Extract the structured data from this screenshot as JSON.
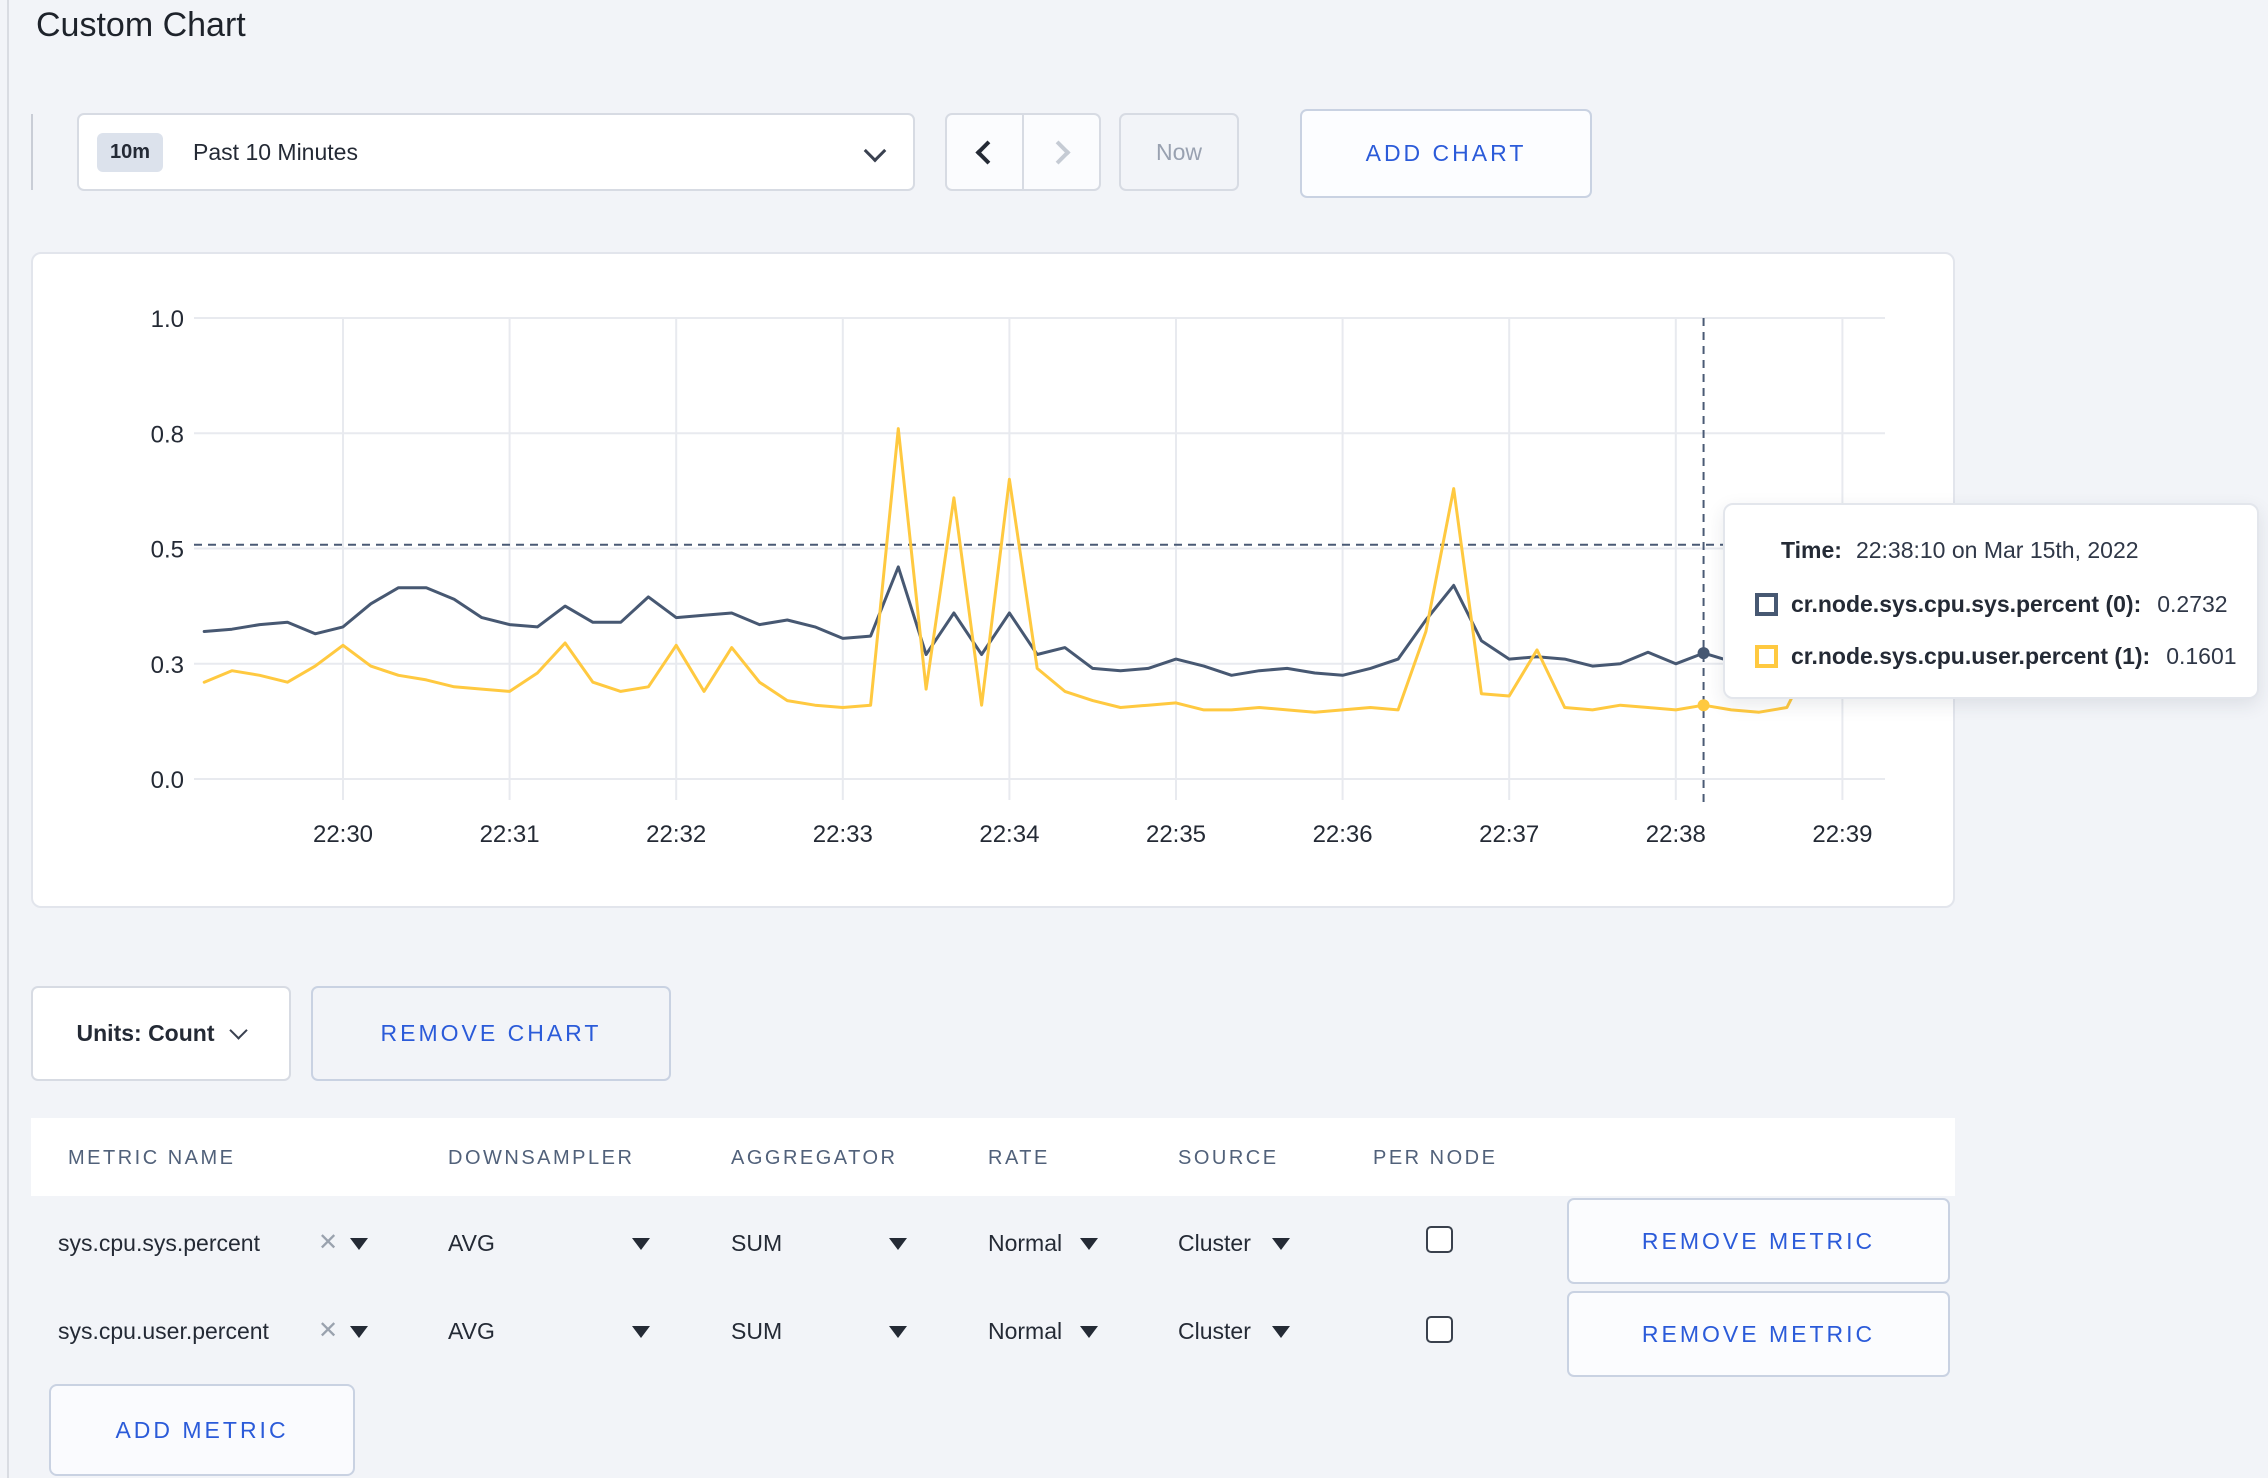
{
  "page": {
    "title": "Custom Chart"
  },
  "toolbar": {
    "time_range": {
      "badge": "10m",
      "label": "Past 10 Minutes"
    },
    "now_label": "Now",
    "add_chart_label": "ADD CHART"
  },
  "icons": {
    "clear": "✕"
  },
  "chart_data": {
    "type": "line",
    "title": "",
    "xlabel": "",
    "ylabel": "",
    "grid": true,
    "legend_position": "tooltip",
    "x_axis": {
      "tick_labels": [
        "22:30",
        "22:31",
        "22:32",
        "22:33",
        "22:34",
        "22:35",
        "22:36",
        "22:37",
        "22:38",
        "22:39"
      ],
      "start_time": "22:29:10",
      "interval_seconds": 10,
      "point_count": 61
    },
    "y_axis": {
      "tick_labels": [
        "0.0",
        "0.3",
        "0.5",
        "0.8",
        "1.0"
      ],
      "tick_values": [
        0,
        0.25,
        0.5,
        0.75,
        1
      ],
      "range": [
        0,
        1
      ]
    },
    "series": [
      {
        "name": "cr.node.sys.cpu.sys.percent (0)",
        "color": "#475872",
        "values": [
          0.32,
          0.325,
          0.335,
          0.34,
          0.315,
          0.33,
          0.38,
          0.415,
          0.415,
          0.39,
          0.35,
          0.335,
          0.33,
          0.375,
          0.34,
          0.34,
          0.395,
          0.35,
          0.355,
          0.36,
          0.335,
          0.345,
          0.33,
          0.305,
          0.31,
          0.46,
          0.27,
          0.36,
          0.27,
          0.36,
          0.27,
          0.285,
          0.24,
          0.235,
          0.24,
          0.26,
          0.245,
          0.225,
          0.235,
          0.24,
          0.23,
          0.225,
          0.24,
          0.26,
          0.345,
          0.42,
          0.3,
          0.26,
          0.265,
          0.26,
          0.245,
          0.25,
          0.275,
          0.25,
          0.273,
          0.255,
          0.26,
          0.27,
          0.265,
          0.27,
          0.275
        ]
      },
      {
        "name": "cr.node.sys.cpu.user.percent (1)",
        "color": "#FFC940",
        "values": [
          0.21,
          0.235,
          0.225,
          0.21,
          0.245,
          0.29,
          0.245,
          0.225,
          0.215,
          0.2,
          0.195,
          0.19,
          0.23,
          0.295,
          0.21,
          0.19,
          0.2,
          0.29,
          0.19,
          0.285,
          0.21,
          0.17,
          0.16,
          0.155,
          0.16,
          0.76,
          0.195,
          0.61,
          0.16,
          0.65,
          0.24,
          0.19,
          0.17,
          0.155,
          0.16,
          0.165,
          0.15,
          0.15,
          0.155,
          0.15,
          0.145,
          0.15,
          0.155,
          0.15,
          0.32,
          0.63,
          0.185,
          0.18,
          0.28,
          0.155,
          0.15,
          0.16,
          0.155,
          0.15,
          0.16,
          0.15,
          0.145,
          0.155,
          0.275,
          0.27,
          0.22
        ]
      }
    ],
    "crosshair": {
      "index": 54,
      "time": "22:38:10",
      "y_value": 0.508
    }
  },
  "tooltip": {
    "time_label": "Time:",
    "time_value": "22:38:10 on Mar 15th, 2022",
    "rows": [
      {
        "label": "cr.node.sys.cpu.sys.percent (0):",
        "value": "0.2732",
        "color": "#475872"
      },
      {
        "label": "cr.node.sys.cpu.user.percent (1):",
        "value": "0.1601",
        "color": "#FFC940"
      }
    ]
  },
  "chart_controls": {
    "units_label": "Units: Count",
    "remove_chart_label": "REMOVE CHART"
  },
  "metrics_table": {
    "headers": [
      "METRIC NAME",
      "DOWNSAMPLER",
      "AGGREGATOR",
      "RATE",
      "SOURCE",
      "PER NODE"
    ],
    "rows": [
      {
        "metric": "sys.cpu.sys.percent",
        "downsampler": "AVG",
        "aggregator": "SUM",
        "rate": "Normal",
        "source": "Cluster",
        "per_node_checked": false,
        "remove_label": "REMOVE METRIC"
      },
      {
        "metric": "sys.cpu.user.percent",
        "downsampler": "AVG",
        "aggregator": "SUM",
        "rate": "Normal",
        "source": "Cluster",
        "per_node_checked": false,
        "remove_label": "REMOVE METRIC"
      }
    ],
    "add_metric_label": "ADD METRIC"
  },
  "colors": {
    "accent_blue": "#2B5BD9",
    "page_background": "#F2F4F8",
    "grid_line": "#E8EAEF"
  }
}
